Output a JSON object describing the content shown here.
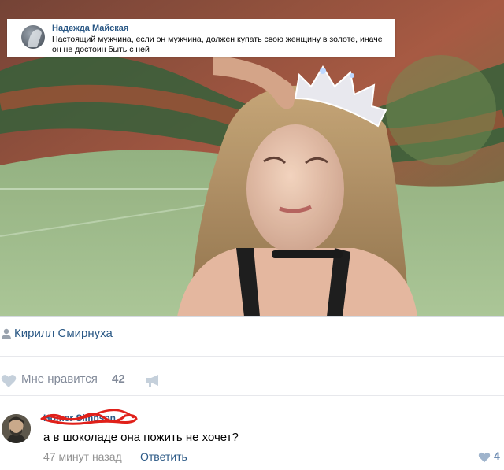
{
  "caption": {
    "author": "Надежда Майская",
    "text": "Настоящий мужчина, если он мужчина, должен купать свою женщину в золоте, иначе он не достоин быть с ней"
  },
  "source": {
    "name": "Кирилл Смирнуха"
  },
  "likes": {
    "label": "Мне нравится",
    "count": "42"
  },
  "comment": {
    "author": "Homer Simpson",
    "text": "а в шоколаде она пожить не хочет?",
    "time": "47 минут назад",
    "reply_label": "Ответить",
    "like_count": "4"
  },
  "colors": {
    "link": "#2a5885",
    "muted": "#828a99",
    "scribble": "#e0201a"
  }
}
